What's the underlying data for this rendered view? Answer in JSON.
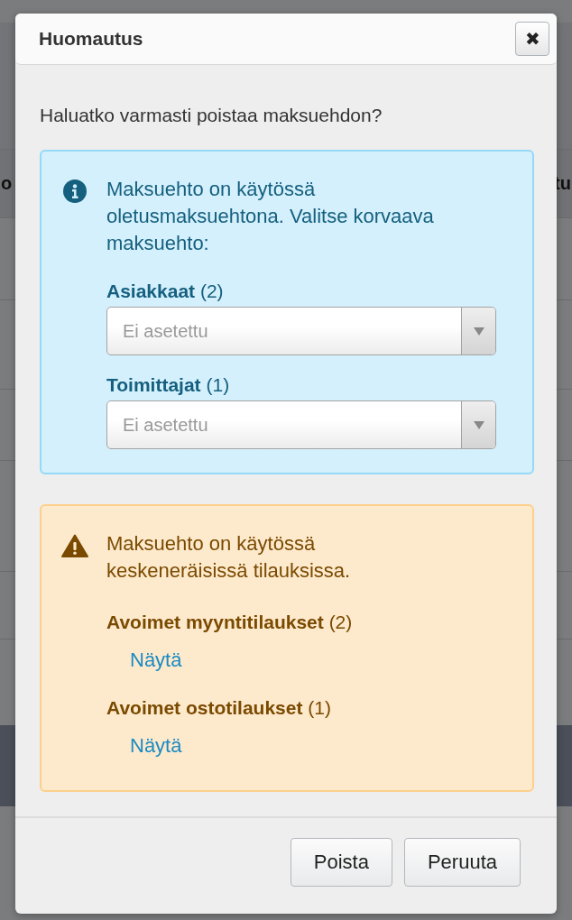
{
  "background": {
    "header_cells": [
      "o",
      "tu"
    ]
  },
  "dialog": {
    "title": "Huomautus",
    "close_label": "✖",
    "question": "Haluatko varmasti poistaa maksuehdon?",
    "alerts": [
      {
        "kind": "info",
        "message": "Maksuehto on käytössä oletusmaksuehtona. Valitse korvaava maksuehto:",
        "items": [
          {
            "kind": "select",
            "label": "**Asiakkaat** (2)",
            "placeholder": "Ei asetettu"
          },
          {
            "kind": "select",
            "label": "**Toimittajat** (1)",
            "placeholder": "Ei asetettu"
          }
        ]
      },
      {
        "kind": "warning",
        "message": "Maksuehto on käytössä keskeneräisissä tilauksissa.",
        "items": [
          {
            "kind": "link",
            "label": "**Avoimet myyntitilaukset** (2)",
            "link": "Näytä"
          },
          {
            "kind": "link",
            "label": "**Avoimet ostotilaukset** (1)",
            "link": "Näytä"
          }
        ]
      }
    ],
    "buttons": [
      "Poista",
      "Peruuta"
    ]
  }
}
